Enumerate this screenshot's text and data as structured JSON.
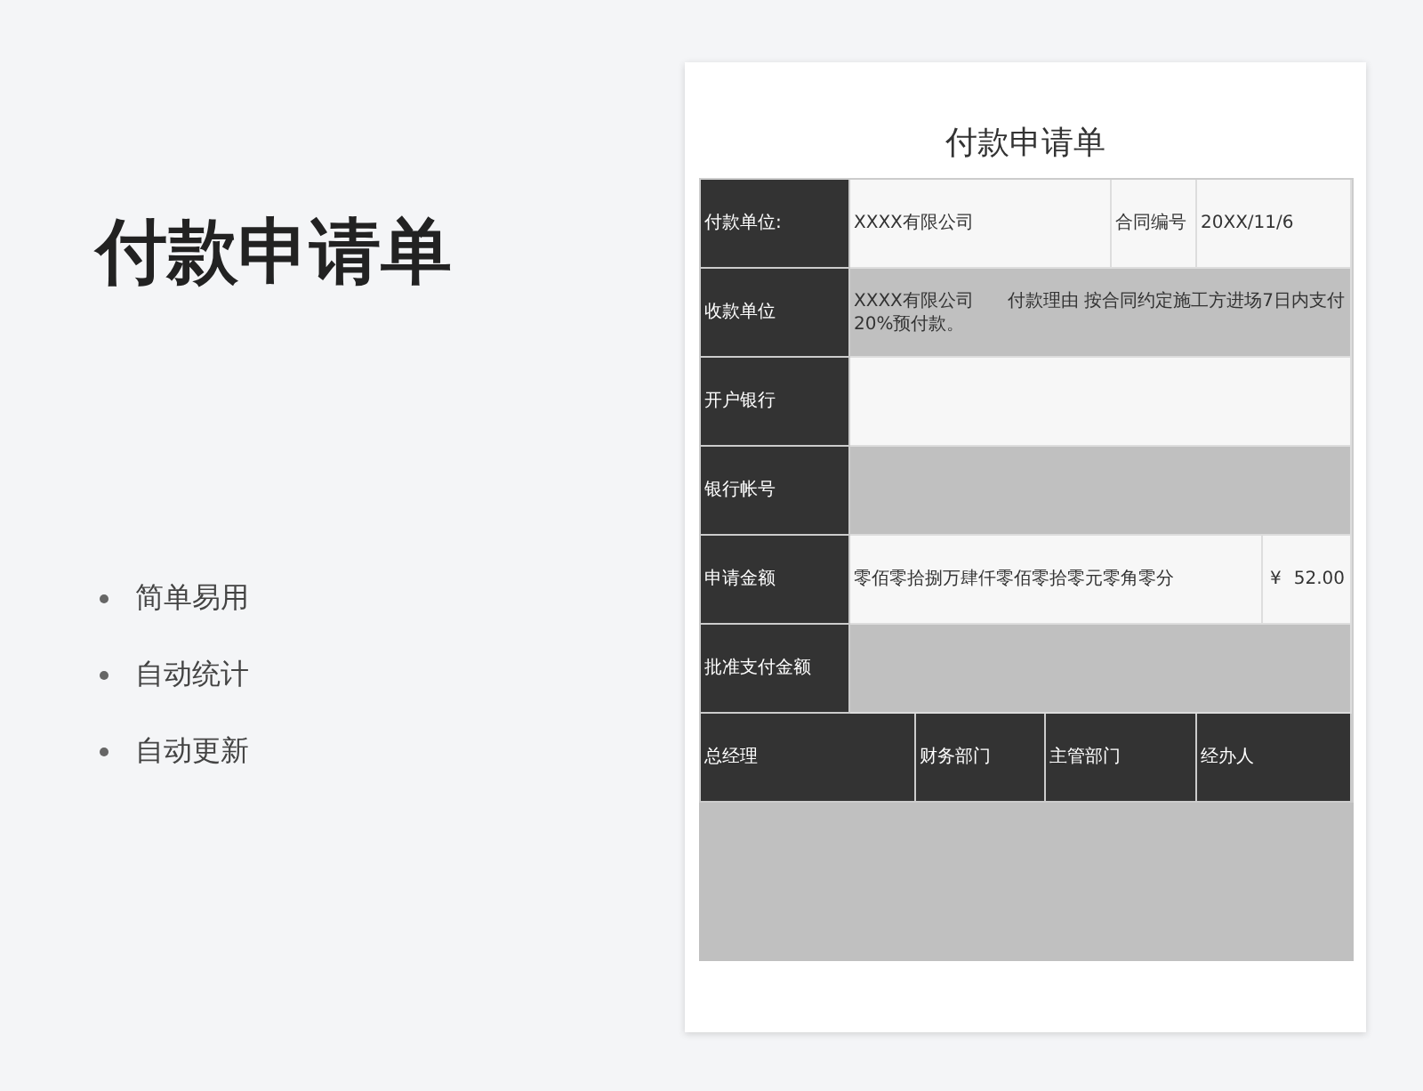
{
  "hero": {
    "title": "付款申请单",
    "features": [
      "简单易用",
      "自动统计",
      "自动更新"
    ]
  },
  "document": {
    "title": "付款申请单",
    "fields": [
      {
        "label": "付款单位:",
        "value": "XXXX有限公司",
        "contract_label": "合同编号",
        "contract_value": "20XX/11/6"
      },
      {
        "label": "收款单位",
        "value": "XXXX有限公司      付款理由 按合同约定施工方进场7日内支付20%预付款。"
      },
      {
        "label": "开户银行"
      },
      {
        "label": "银行帐号"
      },
      {
        "label": "申请金额",
        "value": "零佰零拾捌万肆仟零佰零拾零元零角零分",
        "currency": "¥",
        "amount": "52.00"
      },
      {
        "label": "批准支付金额"
      }
    ],
    "signatures": [
      "总经理",
      "财务部门",
      "主管部门",
      "经办人"
    ]
  }
}
